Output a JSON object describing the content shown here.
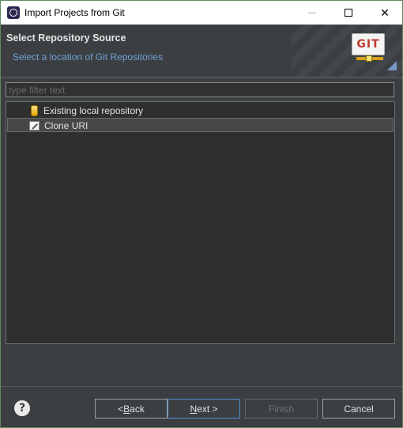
{
  "window": {
    "title": "Import Projects from Git",
    "controls": {
      "minimize_icon": "minimize-icon",
      "maximize_icon": "maximize-icon",
      "close_glyph": "✕"
    }
  },
  "banner": {
    "title": "Select Repository Source",
    "subtitle": "Select a location of Git Repositories",
    "logo_text": "GIT"
  },
  "filter": {
    "placeholder": "type filter text",
    "value": ""
  },
  "tree": {
    "items": [
      {
        "label": "Existing local repository",
        "icon": "repository-icon",
        "selected": false
      },
      {
        "label": "Clone URI",
        "icon": "clone-uri-icon",
        "selected": true
      }
    ]
  },
  "footer": {
    "help_glyph": "?",
    "back_prefix": "< ",
    "back_mnemonic": "B",
    "back_rest": "ack",
    "next_mnemonic": "N",
    "next_rest": "ext >",
    "finish_label": "Finish",
    "cancel_label": "Cancel"
  },
  "colors": {
    "background": "#3c3f41",
    "subtitle": "#6fa0d8",
    "focus_border": "#4e8fd6"
  }
}
